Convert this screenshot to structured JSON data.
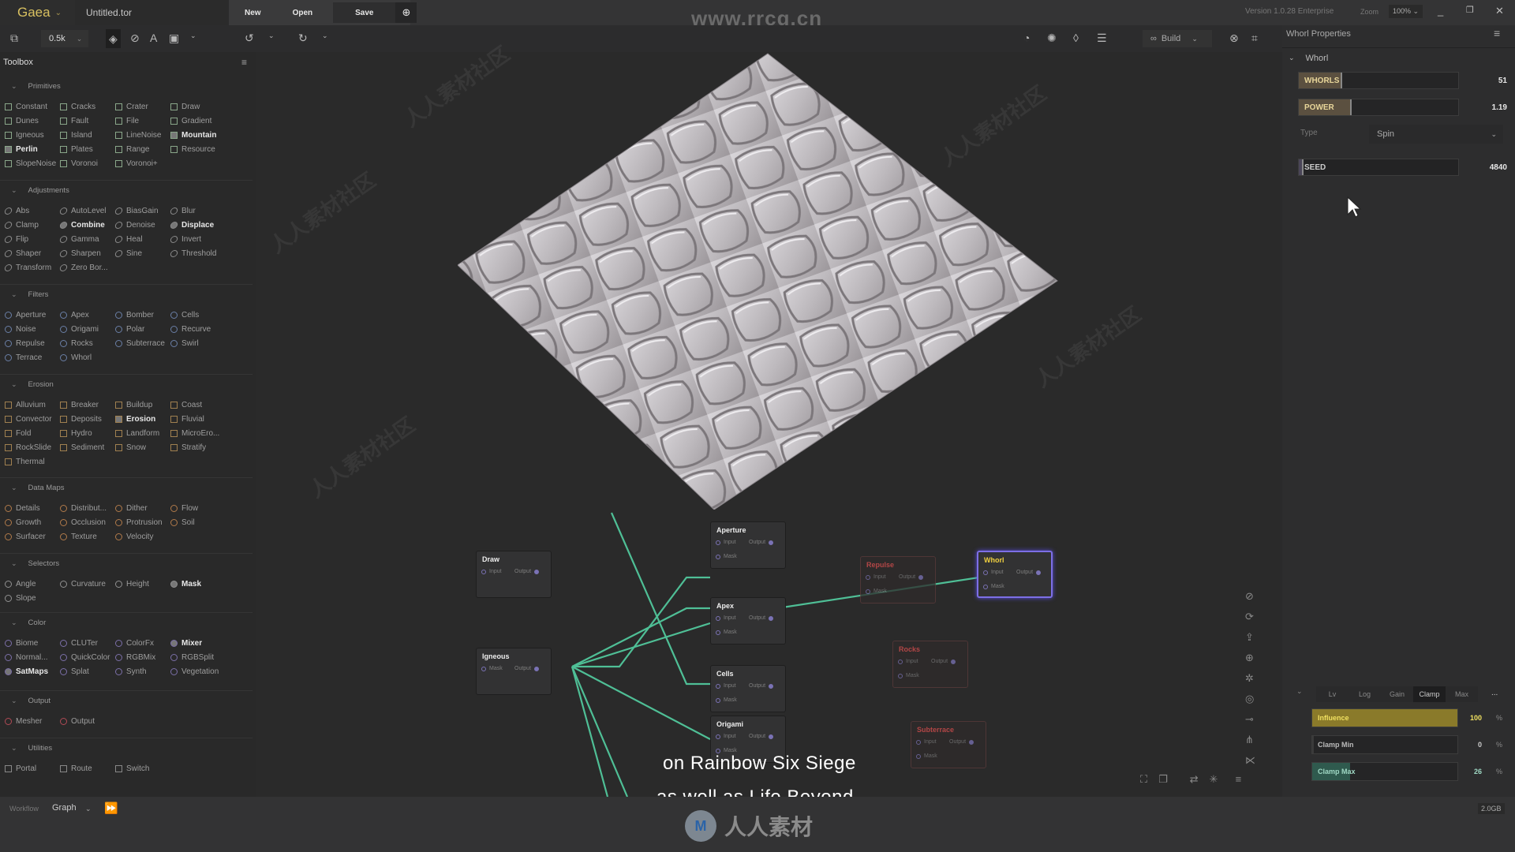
{
  "app": {
    "name": "Gaea",
    "document": "Untitled.tor",
    "version": "Version 1.0.28 Enterprise",
    "zoom_label": "Zoom",
    "zoom_value": "100%",
    "file_buttons": {
      "new": "New",
      "open": "Open",
      "save": "Save"
    },
    "watermark_url": "www.rrcg.cn"
  },
  "toolbar": {
    "resolution": "0.5k",
    "build_label": "Build",
    "icons": [
      "add-layer-icon",
      "view-3d-icon",
      "compass-icon",
      "angle-icon",
      "camera-icon",
      "undo-icon",
      "redo-icon",
      "lighting-icon",
      "sun-icon",
      "water-icon",
      "layers-icon",
      "build-icon",
      "target-icon",
      "chip-icon"
    ]
  },
  "toolbox": {
    "title": "Toolbox",
    "sections": [
      {
        "name": "Primitives",
        "shape": "square",
        "variant": "prim",
        "items": [
          {
            "label": "Constant"
          },
          {
            "label": "Cracks"
          },
          {
            "label": "Crater"
          },
          {
            "label": "Draw"
          },
          {
            "label": "Dunes"
          },
          {
            "label": "Fault"
          },
          {
            "label": "File"
          },
          {
            "label": "Gradient"
          },
          {
            "label": "Igneous"
          },
          {
            "label": "Island"
          },
          {
            "label": "LineNoise"
          },
          {
            "label": "Mountain",
            "bold": true
          },
          {
            "label": "Perlin",
            "bold": true
          },
          {
            "label": "Plates"
          },
          {
            "label": "Range"
          },
          {
            "label": "Resource"
          },
          {
            "label": "SlopeNoise"
          },
          {
            "label": "Voronoi"
          },
          {
            "label": "Voronoi+"
          }
        ]
      },
      {
        "name": "Adjustments",
        "shape": "circle",
        "variant": "adj",
        "items": [
          {
            "label": "Abs"
          },
          {
            "label": "AutoLevel"
          },
          {
            "label": "BiasGain"
          },
          {
            "label": "Blur"
          },
          {
            "label": "Clamp"
          },
          {
            "label": "Combine",
            "bold": true
          },
          {
            "label": "Denoise"
          },
          {
            "label": "Displace",
            "bold": true
          },
          {
            "label": "Flip"
          },
          {
            "label": "Gamma"
          },
          {
            "label": "Heal"
          },
          {
            "label": "Invert"
          },
          {
            "label": "Shaper"
          },
          {
            "label": "Sharpen"
          },
          {
            "label": "Sine"
          },
          {
            "label": "Threshold"
          },
          {
            "label": "Transform"
          },
          {
            "label": "Zero Bor..."
          }
        ]
      },
      {
        "name": "Filters",
        "shape": "circle",
        "variant": "filt",
        "items": [
          {
            "label": "Aperture"
          },
          {
            "label": "Apex"
          },
          {
            "label": "Bomber"
          },
          {
            "label": "Cells"
          },
          {
            "label": "Noise"
          },
          {
            "label": "Origami"
          },
          {
            "label": "Polar"
          },
          {
            "label": "Recurve"
          },
          {
            "label": "Repulse"
          },
          {
            "label": "Rocks"
          },
          {
            "label": "Subterrace"
          },
          {
            "label": "Swirl"
          },
          {
            "label": "Terrace"
          },
          {
            "label": "Whorl"
          }
        ]
      },
      {
        "name": "Erosion",
        "shape": "square",
        "variant": "ero",
        "items": [
          {
            "label": "Alluvium"
          },
          {
            "label": "Breaker"
          },
          {
            "label": "Buildup"
          },
          {
            "label": "Coast"
          },
          {
            "label": "Convector"
          },
          {
            "label": "Deposits"
          },
          {
            "label": "Erosion",
            "bold": true
          },
          {
            "label": "Fluvial"
          },
          {
            "label": "Fold"
          },
          {
            "label": "Hydro"
          },
          {
            "label": "Landform"
          },
          {
            "label": "MicroEro..."
          },
          {
            "label": "RockSlide"
          },
          {
            "label": "Sediment"
          },
          {
            "label": "Snow"
          },
          {
            "label": "Stratify"
          },
          {
            "label": "Thermal"
          }
        ]
      },
      {
        "name": "Data Maps",
        "shape": "circle",
        "variant": "dm",
        "items": [
          {
            "label": "Details"
          },
          {
            "label": "Distribut..."
          },
          {
            "label": "Dither"
          },
          {
            "label": "Flow"
          },
          {
            "label": "Growth"
          },
          {
            "label": "Occlusion"
          },
          {
            "label": "Protrusion"
          },
          {
            "label": "Soil"
          },
          {
            "label": "Surfacer"
          },
          {
            "label": "Texture"
          },
          {
            "label": "Velocity"
          }
        ]
      },
      {
        "name": "Selectors",
        "shape": "circle",
        "variant": "sel",
        "items": [
          {
            "label": "Angle"
          },
          {
            "label": "Curvature"
          },
          {
            "label": "Height"
          },
          {
            "label": "Mask",
            "bold": true
          },
          {
            "label": "Slope"
          }
        ]
      },
      {
        "name": "Color",
        "shape": "circle",
        "variant": "col",
        "items": [
          {
            "label": "Biome"
          },
          {
            "label": "CLUTer"
          },
          {
            "label": "ColorFx"
          },
          {
            "label": "Mixer",
            "bold": true
          },
          {
            "label": "Normal..."
          },
          {
            "label": "QuickColor"
          },
          {
            "label": "RGBMix"
          },
          {
            "label": "RGBSplit"
          },
          {
            "label": "SatMaps",
            "bold": true
          },
          {
            "label": "Splat"
          },
          {
            "label": "Synth"
          },
          {
            "label": "Vegetation"
          }
        ]
      },
      {
        "name": "Output",
        "shape": "circle",
        "variant": "out",
        "items": [
          {
            "label": "Mesher"
          },
          {
            "label": "Output"
          }
        ]
      },
      {
        "name": "Utilities",
        "shape": "square",
        "variant": "util",
        "items": [
          {
            "label": "Portal"
          },
          {
            "label": "Route"
          },
          {
            "label": "Switch"
          }
        ]
      }
    ]
  },
  "graph": {
    "nodes": [
      {
        "id": "draw",
        "title": "Draw",
        "ports": [
          "Input",
          "Output"
        ]
      },
      {
        "id": "igneous",
        "title": "Igneous",
        "ports": [
          "Mask",
          "Output"
        ]
      },
      {
        "id": "aperture",
        "title": "Aperture",
        "ports": [
          "Input",
          "Output",
          "Mask"
        ]
      },
      {
        "id": "apex",
        "title": "Apex",
        "ports": [
          "Input",
          "Output",
          "Mask"
        ]
      },
      {
        "id": "cells",
        "title": "Cells",
        "ports": [
          "Input",
          "Output",
          "Mask"
        ]
      },
      {
        "id": "origami",
        "title": "Origami",
        "ports": [
          "Input",
          "Output",
          "Mask"
        ]
      },
      {
        "id": "repulse",
        "title": "Repulse",
        "ports": [
          "Input",
          "Output",
          "Mask"
        ],
        "state": "disabled"
      },
      {
        "id": "whorl",
        "title": "Whorl",
        "ports": [
          "Input",
          "Output",
          "Mask"
        ],
        "state": "selected"
      },
      {
        "id": "rocks",
        "title": "Rocks",
        "ports": [
          "Input",
          "Output",
          "Mask"
        ],
        "state": "disabled"
      },
      {
        "id": "subterrace",
        "title": "Subterrace",
        "ports": [
          "Input",
          "Output",
          "Mask"
        ],
        "state": "disabled"
      }
    ],
    "wire_color": "#4fbf96",
    "selected_color": "#7d6fe6",
    "disabled_title_color": "#e05050"
  },
  "subtitles": [
    "on Rainbow Six Siege",
    "as well as Life Beyond."
  ],
  "brand_watermark": "人人素材",
  "properties": {
    "title": "Whorl Properties",
    "section": "Whorl",
    "whorls": {
      "label": "WHORLS",
      "value": "51",
      "fraction": 0.27
    },
    "power": {
      "label": "POWER",
      "value": "1.19",
      "fraction": 0.33
    },
    "type": {
      "label": "Type",
      "value": "Spin"
    },
    "seed": {
      "label": "SEED",
      "value": "4840",
      "fraction": 0.03
    },
    "modifier_tabs": [
      "Lv",
      "Log",
      "Gain",
      "Clamp",
      "Max"
    ],
    "active_modifier": "Clamp",
    "more": "...",
    "influence": {
      "label": "Influence",
      "value": "100",
      "unit": "%",
      "fraction": 1.0,
      "color": "#8a7a2a"
    },
    "clamp_min": {
      "label": "Clamp Min",
      "value": "0",
      "unit": "%",
      "fraction": 0.0
    },
    "clamp_max": {
      "label": "Clamp Max",
      "value": "26",
      "unit": "%",
      "fraction": 0.26,
      "color": "#2f5a4e"
    }
  },
  "status": {
    "workflow_label": "Workflow",
    "workflow_value": "Graph",
    "memory": "2.0GB"
  }
}
